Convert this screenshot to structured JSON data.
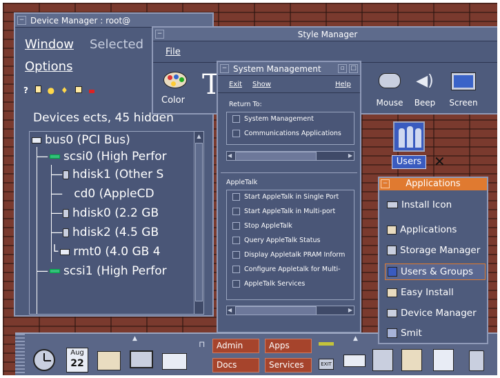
{
  "device_manager": {
    "title": "Device Manager : root@",
    "menu": [
      "Window",
      "Selected",
      "Options"
    ],
    "summary": "Devices  ects, 45 hidden",
    "tree": [
      {
        "label": "bus0 (PCI Bus)",
        "icon": "bus-icon"
      },
      {
        "label": "scsi0 (High Perfor",
        "icon": "scsi-icon"
      },
      {
        "label": "hdisk1 (Other S",
        "icon": "disk-icon"
      },
      {
        "label": "cd0 (AppleCD",
        "icon": "cd-icon"
      },
      {
        "label": "hdisk0 (2.2 GB",
        "icon": "disk-icon"
      },
      {
        "label": "hdisk2 (4.5 GB",
        "icon": "disk-icon"
      },
      {
        "label": "rmt0 (4.0 GB 4",
        "icon": "tape-icon"
      },
      {
        "label": "scsi1 (High Perfor",
        "icon": "scsi-icon"
      }
    ]
  },
  "style_manager": {
    "title": "Style Manager",
    "menu": [
      "File"
    ],
    "items": [
      "Color",
      "Mouse",
      "Beep",
      "Screen"
    ],
    "big_letter": "T"
  },
  "system_management": {
    "title": "System Management",
    "menu": {
      "exit": "Exit",
      "show": "Show",
      "help": "Help"
    },
    "return_to_label": "Return To:",
    "return_to": [
      "System Management",
      "Communications Applications"
    ],
    "section_label": "AppleTalk",
    "appletalk": [
      "Start AppleTalk in Single Port",
      "Start AppleTalk in Multi-port",
      "Stop AppleTalk",
      "Query AppleTalk Status",
      "Display Appletalk PRAM Inform",
      "Configure Appletalk for Multi-",
      "AppleTalk Services"
    ]
  },
  "desktop": {
    "users_label": "Users"
  },
  "applications": {
    "title": "Applications",
    "items": [
      "Install Icon",
      "Applications",
      "Storage Manager",
      "Users & Groups",
      "Easy Install",
      "Device Manager",
      "Smit"
    ],
    "selected_index": 3
  },
  "front_panel": {
    "calendar_month": "Aug",
    "calendar_day": "22",
    "workspaces": [
      "Admin",
      "Apps",
      "Docs",
      "Services"
    ],
    "exit_label": "EXIT"
  },
  "colors": {
    "window_bg": "#4e5b7c",
    "titlebar": "#5e6b8c",
    "accent": "#e07a30",
    "workspace_button": "#a6442c",
    "backdrop": "#7a3a2e"
  }
}
